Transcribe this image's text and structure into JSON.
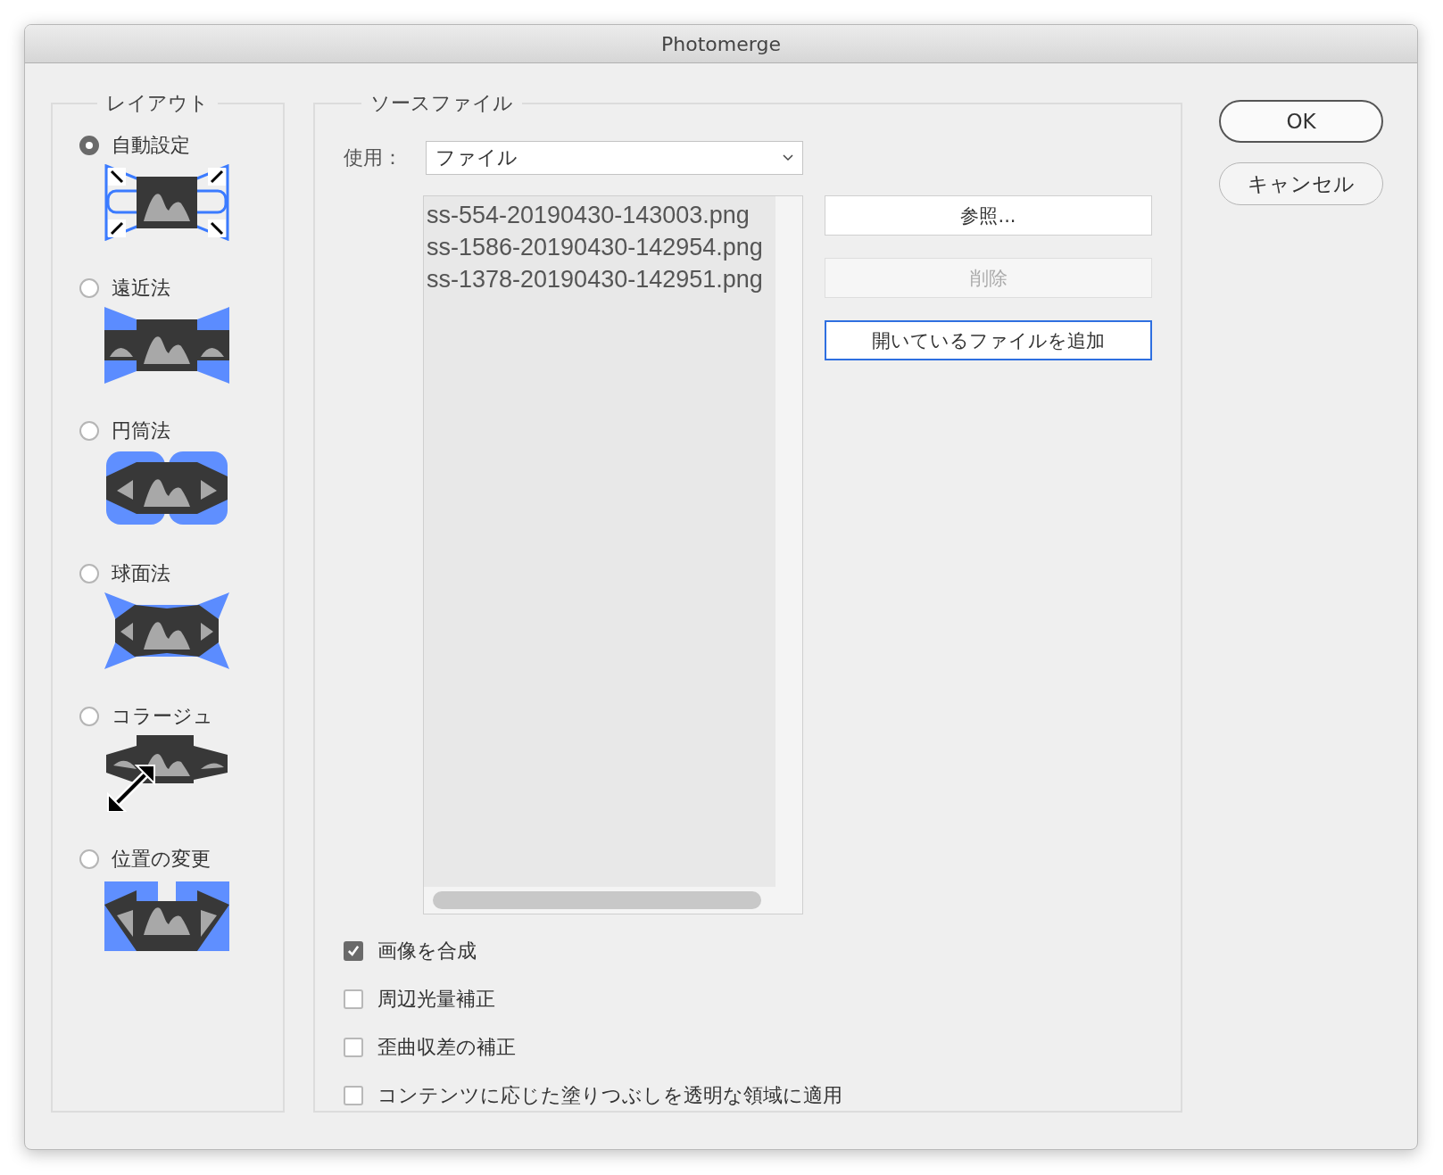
{
  "window": {
    "title": "Photomerge"
  },
  "layout": {
    "legend": "レイアウト",
    "options": [
      {
        "label": "自動設定",
        "selected": true,
        "kind": "auto"
      },
      {
        "label": "遠近法",
        "selected": false,
        "kind": "perspective"
      },
      {
        "label": "円筒法",
        "selected": false,
        "kind": "cylindrical"
      },
      {
        "label": "球面法",
        "selected": false,
        "kind": "spherical"
      },
      {
        "label": "コラージュ",
        "selected": false,
        "kind": "collage"
      },
      {
        "label": "位置の変更",
        "selected": false,
        "kind": "reposition"
      }
    ]
  },
  "source": {
    "legend": "ソースファイル",
    "use_label": "使用：",
    "use_value": "ファイル",
    "files": [
      "ss-554-20190430-143003.png",
      "ss-1586-20190430-142954.png",
      "ss-1378-20190430-142951.png"
    ],
    "buttons": [
      {
        "label": "参照...",
        "disabled": false,
        "focused": false
      },
      {
        "label": "削除",
        "disabled": true,
        "focused": false
      },
      {
        "label": "開いているファイルを追加",
        "disabled": false,
        "focused": true
      }
    ],
    "options": [
      {
        "label": "画像を合成",
        "checked": true
      },
      {
        "label": "周辺光量補正",
        "checked": false
      },
      {
        "label": "歪曲収差の補正",
        "checked": false
      },
      {
        "label": "コンテンツに応じた塗りつぶしを透明な領域に適用",
        "checked": false
      }
    ]
  },
  "actions": [
    {
      "label": "OK",
      "default": true
    },
    {
      "label": "キャンセル",
      "default": false
    }
  ]
}
